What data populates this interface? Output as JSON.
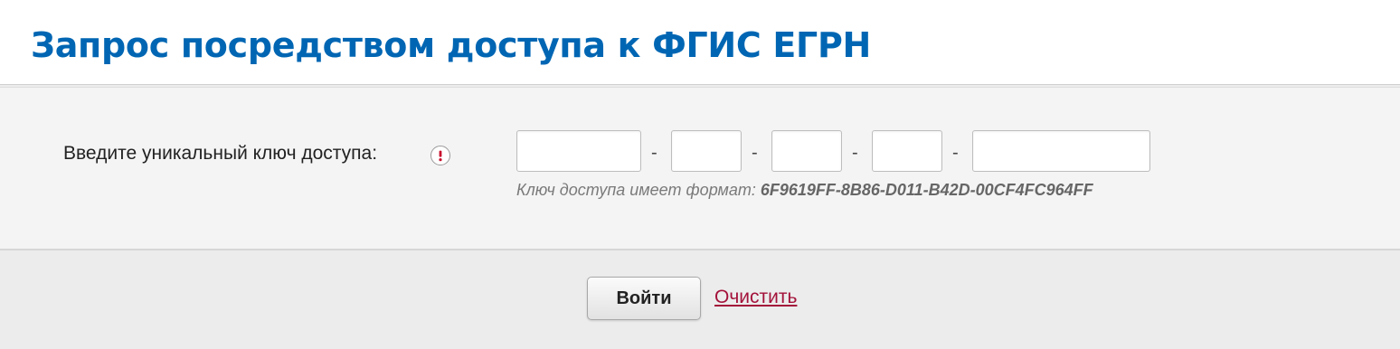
{
  "page": {
    "title": "Запрос посредством доступа к ФГИС ЕГРН"
  },
  "form": {
    "key_label": "Введите уникальный ключ доступа:",
    "info_icon": "exclamation-info-icon",
    "segments": [
      {
        "value": "",
        "placeholder": ""
      },
      {
        "value": "",
        "placeholder": ""
      },
      {
        "value": "",
        "placeholder": ""
      },
      {
        "value": "",
        "placeholder": ""
      },
      {
        "value": "",
        "placeholder": ""
      }
    ],
    "separator": "-",
    "format_hint_prefix": "Ключ доступа имеет формат: ",
    "format_example": "6F9619FF-8B86-D011-B42D-00CF4FC964FF"
  },
  "actions": {
    "login_label": "Войти",
    "clear_label": "Очистить"
  },
  "colors": {
    "title": "#0066b3",
    "link": "#a3123a",
    "info_icon_mark": "#c8102e",
    "form_background": "#f4f4f4",
    "action_background": "#ececec"
  }
}
